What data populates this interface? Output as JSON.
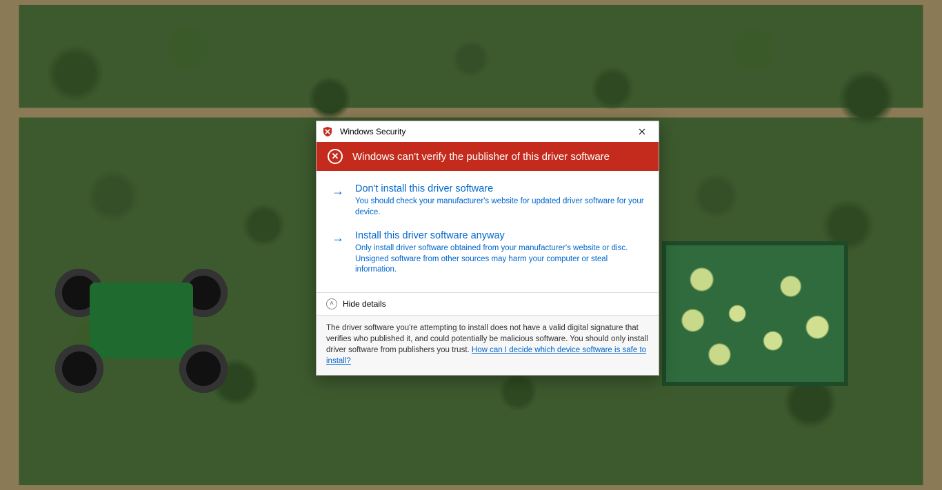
{
  "dialog": {
    "title": "Windows Security",
    "banner": "Windows can't verify the publisher of this driver software",
    "options": [
      {
        "title": "Don't install this driver software",
        "desc": "You should check your manufacturer's website for updated driver software for your device."
      },
      {
        "title": "Install this driver software anyway",
        "desc": "Only install driver software obtained from your manufacturer's website or disc. Unsigned software from other sources may harm your computer or steal information."
      }
    ],
    "toggle_label": "Hide details",
    "details_text": "The driver software you're attempting to install does not have a valid digital signature that verifies who published it, and could potentially be malicious software.  You should only install driver software from publishers you trust.  ",
    "details_link": "How can I decide which device software is safe to install?"
  }
}
